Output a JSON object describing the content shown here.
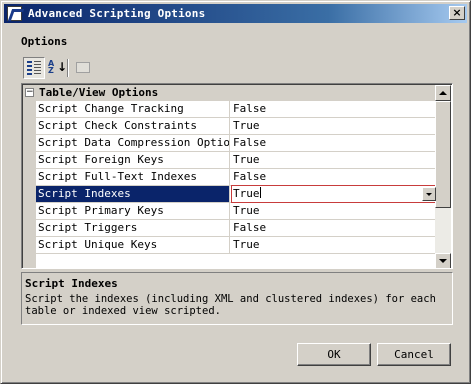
{
  "window": {
    "title": "Advanced Scripting Options",
    "close_glyph": "×"
  },
  "options_label": "Options",
  "toolbar": {
    "categorized_icon": "categorized-icon",
    "alphabetical_icon": "sort-az-icon",
    "alphabetical_label": "AZ",
    "alphabetical_arrow": "↓",
    "property_pages_icon": "property-pages-icon"
  },
  "grid": {
    "category": {
      "expander": "−",
      "label": "Table/View Options"
    },
    "rows": [
      {
        "name": "Script Change Tracking",
        "value": "False"
      },
      {
        "name": "Script Check Constraints",
        "value": "True"
      },
      {
        "name": "Script Data Compression Options",
        "value": "False"
      },
      {
        "name": "Script Foreign Keys",
        "value": "True"
      },
      {
        "name": "Script Full-Text Indexes",
        "value": "False"
      },
      {
        "name": "Script Indexes",
        "value": "True"
      },
      {
        "name": "Script Primary Keys",
        "value": "True"
      },
      {
        "name": "Script Triggers",
        "value": "False"
      },
      {
        "name": "Script Unique Keys",
        "value": "True"
      }
    ],
    "selected_index": 5
  },
  "description": {
    "title": "Script Indexes",
    "text": "Script the indexes (including XML and clustered indexes) for each table or indexed view scripted."
  },
  "buttons": {
    "ok": "OK",
    "cancel": "Cancel"
  }
}
